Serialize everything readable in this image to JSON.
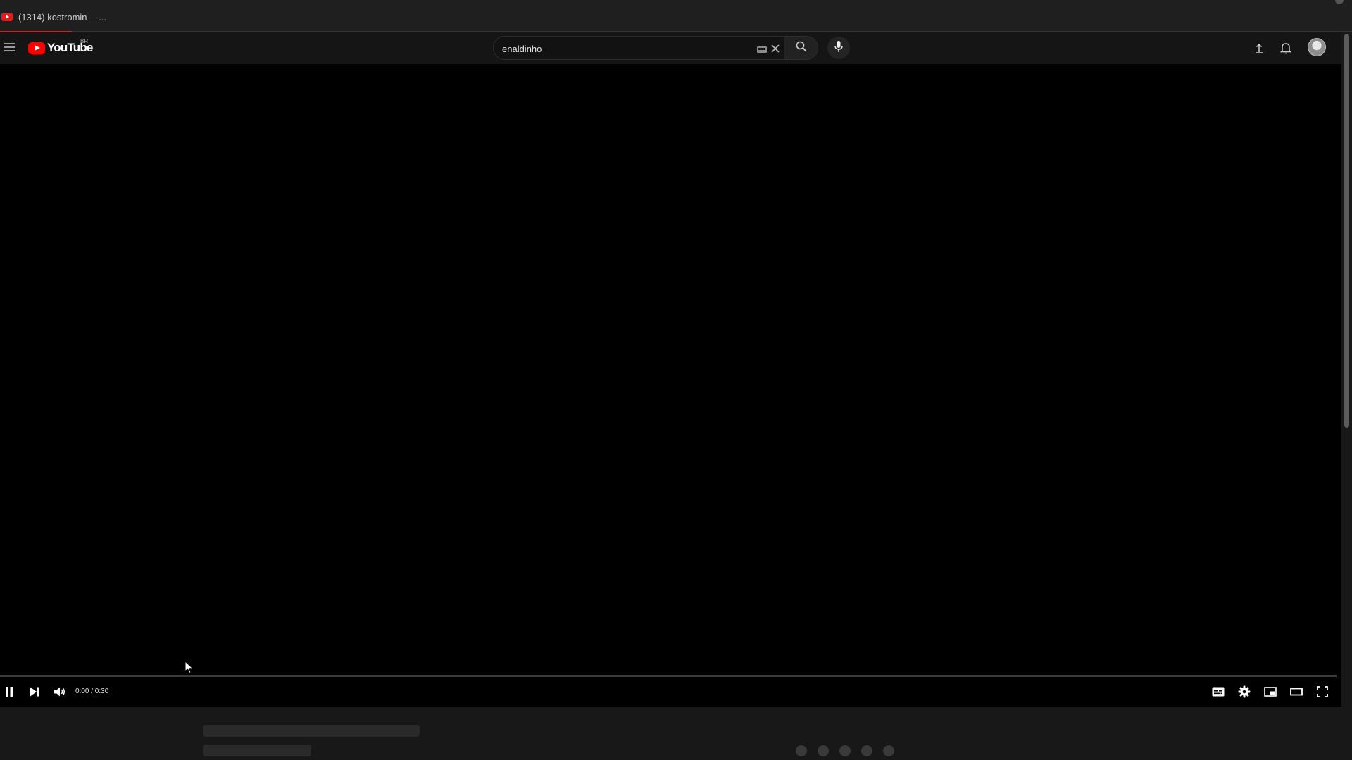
{
  "browser": {
    "tab_title": "(1314) kostromin —...",
    "load_progress_fraction": 0.053,
    "favicon_color": "#e21b1b"
  },
  "masthead": {
    "menu_icon": "hamburger-menu-icon",
    "logo_text": "YouTube",
    "country_code": "BR",
    "brand_color": "#ff0000",
    "search": {
      "value": "enaldinho",
      "keyboard_icon": "keyboard-icon",
      "clear_icon": "close-icon",
      "search_icon": "search-icon"
    },
    "mic_icon": "microphone-icon",
    "upload_icon": "upload-icon",
    "notifications_icon": "bell-icon",
    "avatar_icon": "avatar"
  },
  "player": {
    "time_display": "0:00 / 0:30",
    "progress_fraction": 0.0,
    "state": "playing",
    "controls_left": [
      "pause-icon",
      "next-icon",
      "volume-icon"
    ],
    "controls_right": [
      "subtitles-icon",
      "settings-icon",
      "miniplayer-icon",
      "theater-mode-icon",
      "fullscreen-icon"
    ],
    "accent_color": "#ff0000"
  },
  "below_player": {
    "loading_dots": 5
  }
}
